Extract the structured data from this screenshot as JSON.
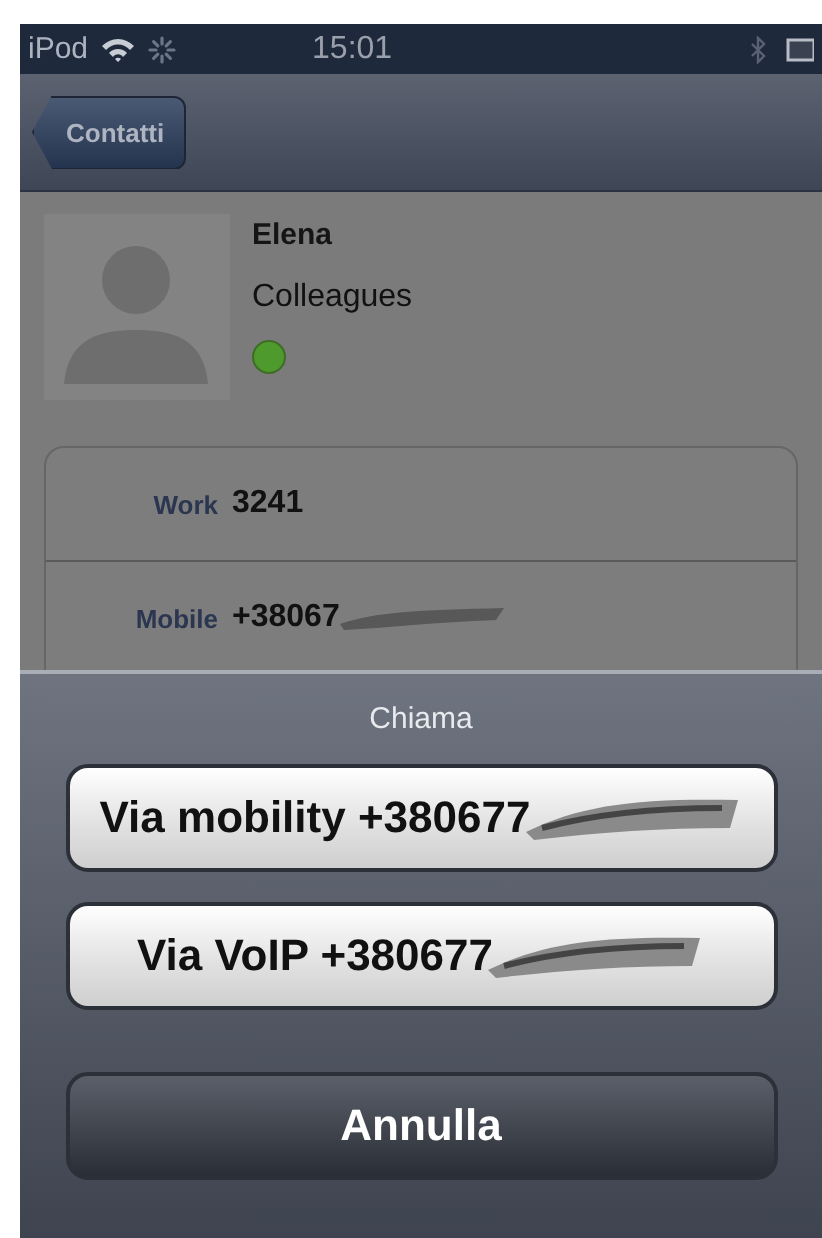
{
  "status_bar": {
    "carrier": "iPod",
    "time": "15:01"
  },
  "nav_bar": {
    "back_button": "Contatti"
  },
  "contact": {
    "name": "Elena",
    "group": "Colleagues",
    "online": true
  },
  "phones": [
    {
      "label": "Work",
      "number": "3241",
      "redacted": false
    },
    {
      "label": "Mobile",
      "number": "+38067",
      "redacted": true
    }
  ],
  "action_sheet": {
    "title": "Chiama",
    "options": [
      {
        "label": "Via mobility +380677",
        "kind": "default",
        "redacted": true
      },
      {
        "label": "Via VoIP +380677",
        "kind": "default",
        "redacted": true
      },
      {
        "label": "Annulla",
        "kind": "cancel",
        "redacted": false
      }
    ]
  }
}
